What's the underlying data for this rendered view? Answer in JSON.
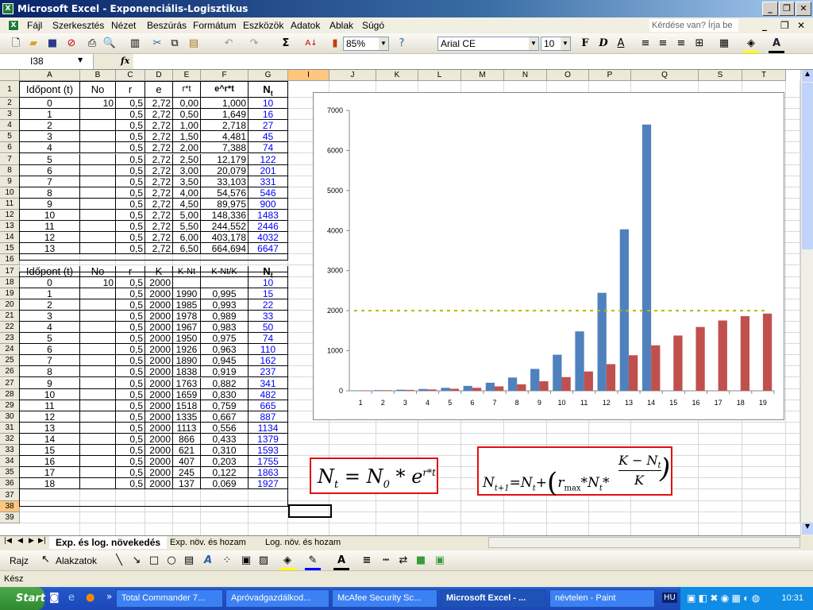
{
  "window": {
    "title": "Microsoft Excel - Exponenciális-Logisztikus",
    "min": "_",
    "max": "❐",
    "close": "✕"
  },
  "menu": [
    "Fájl",
    "Szerkesztés",
    "Nézet",
    "Beszúrás",
    "Formátum",
    "Eszközök",
    "Adatok",
    "Ablak",
    "Súgó"
  ],
  "ask_placeholder": "Kérdése van? Írja be ide.",
  "toolbar": {
    "zoom": "85%",
    "font": "Arial CE",
    "size": "10",
    "bold": "F",
    "italic": "D",
    "underline": "A",
    "sum": "Σ"
  },
  "formula_bar": {
    "name_box": "I38",
    "fx": "fx",
    "value": ""
  },
  "columns": [
    "A",
    "B",
    "C",
    "D",
    "E",
    "F",
    "G",
    "I",
    "J",
    "K",
    "L",
    "M",
    "N",
    "O",
    "P",
    "Q",
    "S",
    "T"
  ],
  "rows": [
    "1",
    "2",
    "3",
    "4",
    "5",
    "6",
    "7",
    "8",
    "9",
    "10",
    "11",
    "12",
    "13",
    "14",
    "15",
    "16",
    "17",
    "18",
    "19",
    "20",
    "21",
    "22",
    "23",
    "24",
    "25",
    "26",
    "27",
    "28",
    "29",
    "30",
    "31",
    "32",
    "33",
    "34",
    "35",
    "36",
    "37",
    "38",
    "39"
  ],
  "table1": {
    "header": [
      "Időpont (t)",
      "No",
      "r",
      "e",
      "r*t",
      "e^r*t",
      "Nt"
    ],
    "rows": [
      [
        "0",
        "10",
        "0,5",
        "2,72",
        "0,00",
        "1,000",
        "10"
      ],
      [
        "1",
        "",
        "0,5",
        "2,72",
        "0,50",
        "1,649",
        "16"
      ],
      [
        "2",
        "",
        "0,5",
        "2,72",
        "1,00",
        "2,718",
        "27"
      ],
      [
        "3",
        "",
        "0,5",
        "2,72",
        "1,50",
        "4,481",
        "45"
      ],
      [
        "4",
        "",
        "0,5",
        "2,72",
        "2,00",
        "7,388",
        "74"
      ],
      [
        "5",
        "",
        "0,5",
        "2,72",
        "2,50",
        "12,179",
        "122"
      ],
      [
        "6",
        "",
        "0,5",
        "2,72",
        "3,00",
        "20,079",
        "201"
      ],
      [
        "7",
        "",
        "0,5",
        "2,72",
        "3,50",
        "33,103",
        "331"
      ],
      [
        "8",
        "",
        "0,5",
        "2,72",
        "4,00",
        "54,576",
        "546"
      ],
      [
        "9",
        "",
        "0,5",
        "2,72",
        "4,50",
        "89,975",
        "900"
      ],
      [
        "10",
        "",
        "0,5",
        "2,72",
        "5,00",
        "148,336",
        "1483"
      ],
      [
        "11",
        "",
        "0,5",
        "2,72",
        "5,50",
        "244,552",
        "2446"
      ],
      [
        "12",
        "",
        "0,5",
        "2,72",
        "6,00",
        "403,178",
        "4032"
      ],
      [
        "13",
        "",
        "0,5",
        "2,72",
        "6,50",
        "664,694",
        "6647"
      ]
    ]
  },
  "table2": {
    "header": [
      "Időpont (t)",
      "No",
      "r",
      "K",
      "K-Nt",
      "K-Nt/K",
      "Nt"
    ],
    "rows": [
      [
        "0",
        "10",
        "0,5",
        "2000",
        "",
        "",
        "10"
      ],
      [
        "1",
        "",
        "0,5",
        "2000",
        "1990",
        "0,995",
        "15"
      ],
      [
        "2",
        "",
        "0,5",
        "2000",
        "1985",
        "0,993",
        "22"
      ],
      [
        "3",
        "",
        "0,5",
        "2000",
        "1978",
        "0,989",
        "33"
      ],
      [
        "4",
        "",
        "0,5",
        "2000",
        "1967",
        "0,983",
        "50"
      ],
      [
        "5",
        "",
        "0,5",
        "2000",
        "1950",
        "0,975",
        "74"
      ],
      [
        "6",
        "",
        "0,5",
        "2000",
        "1926",
        "0,963",
        "110"
      ],
      [
        "7",
        "",
        "0,5",
        "2000",
        "1890",
        "0,945",
        "162"
      ],
      [
        "8",
        "",
        "0,5",
        "2000",
        "1838",
        "0,919",
        "237"
      ],
      [
        "9",
        "",
        "0,5",
        "2000",
        "1763",
        "0,882",
        "341"
      ],
      [
        "10",
        "",
        "0,5",
        "2000",
        "1659",
        "0,830",
        "482"
      ],
      [
        "11",
        "",
        "0,5",
        "2000",
        "1518",
        "0,759",
        "665"
      ],
      [
        "12",
        "",
        "0,5",
        "2000",
        "1335",
        "0,667",
        "887"
      ],
      [
        "13",
        "",
        "0,5",
        "2000",
        "1113",
        "0,556",
        "1134"
      ],
      [
        "14",
        "",
        "0,5",
        "2000",
        "866",
        "0,433",
        "1379"
      ],
      [
        "15",
        "",
        "0,5",
        "2000",
        "621",
        "0,310",
        "1593"
      ],
      [
        "16",
        "",
        "0,5",
        "2000",
        "407",
        "0,203",
        "1755"
      ],
      [
        "17",
        "",
        "0,5",
        "2000",
        "245",
        "0,122",
        "1863"
      ],
      [
        "18",
        "",
        "0,5",
        "2000",
        "137",
        "0,069",
        "1927"
      ]
    ]
  },
  "chart_data": {
    "type": "bar",
    "categories": [
      "1",
      "2",
      "3",
      "4",
      "5",
      "6",
      "7",
      "8",
      "9",
      "10",
      "11",
      "12",
      "13",
      "14",
      "15",
      "16",
      "17",
      "18",
      "19"
    ],
    "series": [
      {
        "values": [
          10,
          16,
          27,
          45,
          74,
          122,
          201,
          331,
          546,
          900,
          1483,
          2446,
          4032,
          6647
        ],
        "color": "#4f81bd"
      },
      {
        "values": [
          10,
          15,
          22,
          33,
          50,
          74,
          110,
          162,
          237,
          341,
          482,
          665,
          887,
          1134,
          1379,
          1593,
          1755,
          1863,
          1927
        ],
        "color": "#c0504d"
      }
    ],
    "reference_line": {
      "value": 2000,
      "color": "#b8b800",
      "style": "dashed"
    },
    "yticks": [
      "0",
      "1000",
      "2000",
      "3000",
      "4000",
      "5000",
      "6000",
      "7000"
    ],
    "ylim": [
      0,
      7000
    ],
    "grid": false,
    "legend": "none"
  },
  "formula1": {
    "lhs": "N",
    "lhs_sub": "t",
    "eq": "=",
    "n0": "N",
    "n0_sub": "0",
    "mul": "*",
    "e": "e",
    "exp": "r*t"
  },
  "formula2": {
    "text_lhs": "N",
    "lhs_sub": "t+1",
    "eq": "=",
    "n": "N",
    "n_sub": "t",
    "plus": "+",
    "r": "r",
    "r_sub": "max",
    "mul": "*",
    "num": "K − N",
    "num_sub": "t",
    "den": "K"
  },
  "sheet_tabs": [
    "Exp. és log. növekedés",
    "Exp. növ. és hozam",
    "Log. növ. és hozam"
  ],
  "drawing": {
    "draw": "Rajz",
    "shapes": "Alakzatok"
  },
  "status": "Kész",
  "taskbar": {
    "start": "Start",
    "tasks": [
      "Total Commander 7...",
      "Apróvadgazdálkod...",
      "McAfee Security Sc...",
      "Microsoft Excel - ...",
      "névtelen - Paint"
    ],
    "lang": "HU",
    "clock": "10:31"
  }
}
